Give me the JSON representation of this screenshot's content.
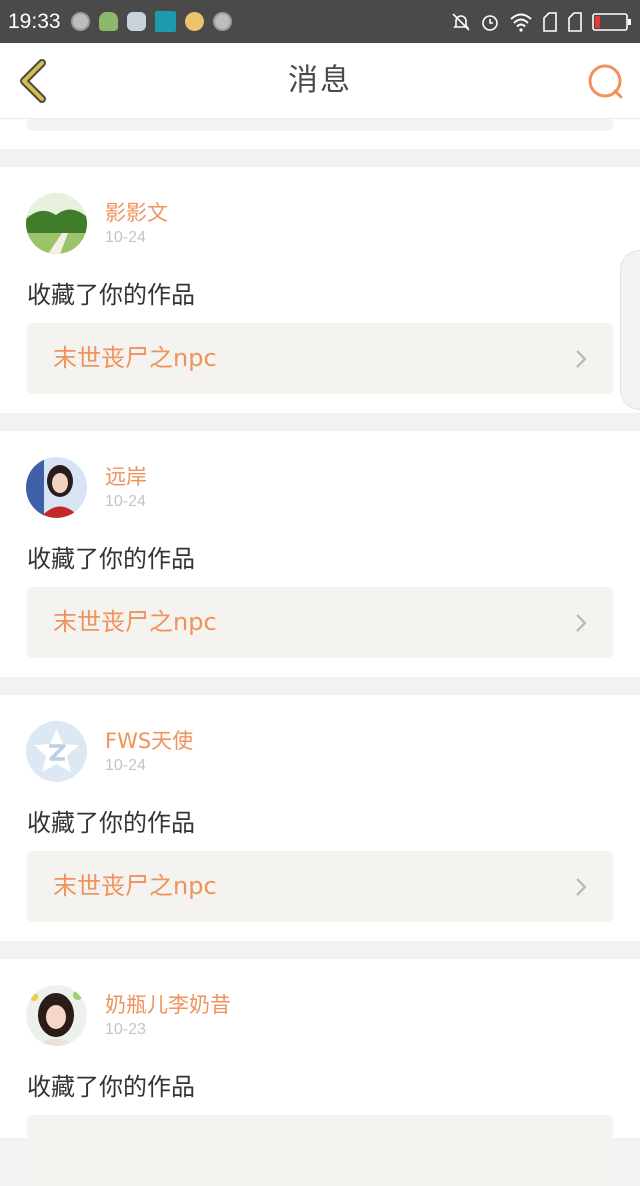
{
  "status_bar": {
    "time": "19:33",
    "left_icons": [
      "notification-icon",
      "tree-icon",
      "db-icon",
      "scan-icon",
      "smile-icon",
      "notification-icon"
    ],
    "right_icons": [
      "bell-off-icon",
      "alarm-icon",
      "wifi-icon",
      "sim-icon",
      "sim-icon",
      "battery-icon"
    ]
  },
  "header": {
    "title": "消息",
    "back_icon": "chevron-left-icon",
    "search_icon": "search-icon"
  },
  "colors": {
    "accent": "#f0935b",
    "back_icon": "#d4b43a",
    "card_bg": "#ffffff",
    "work_bg": "#f4f3ef",
    "page_bg": "#f2f2f2"
  },
  "messages": [
    {
      "user": "影影文",
      "date": "10-24",
      "action": "收藏了你的作品",
      "work": "末世丧尸之npc"
    },
    {
      "user": "远岸",
      "date": "10-24",
      "action": "收藏了你的作品",
      "work": "末世丧尸之npc"
    },
    {
      "user": "FWS天使",
      "date": "10-24",
      "action": "收藏了你的作品",
      "work": "末世丧尸之npc"
    },
    {
      "user": "奶瓶儿李奶昔",
      "date": "10-23",
      "action": "收藏了你的作品",
      "work": ""
    }
  ]
}
